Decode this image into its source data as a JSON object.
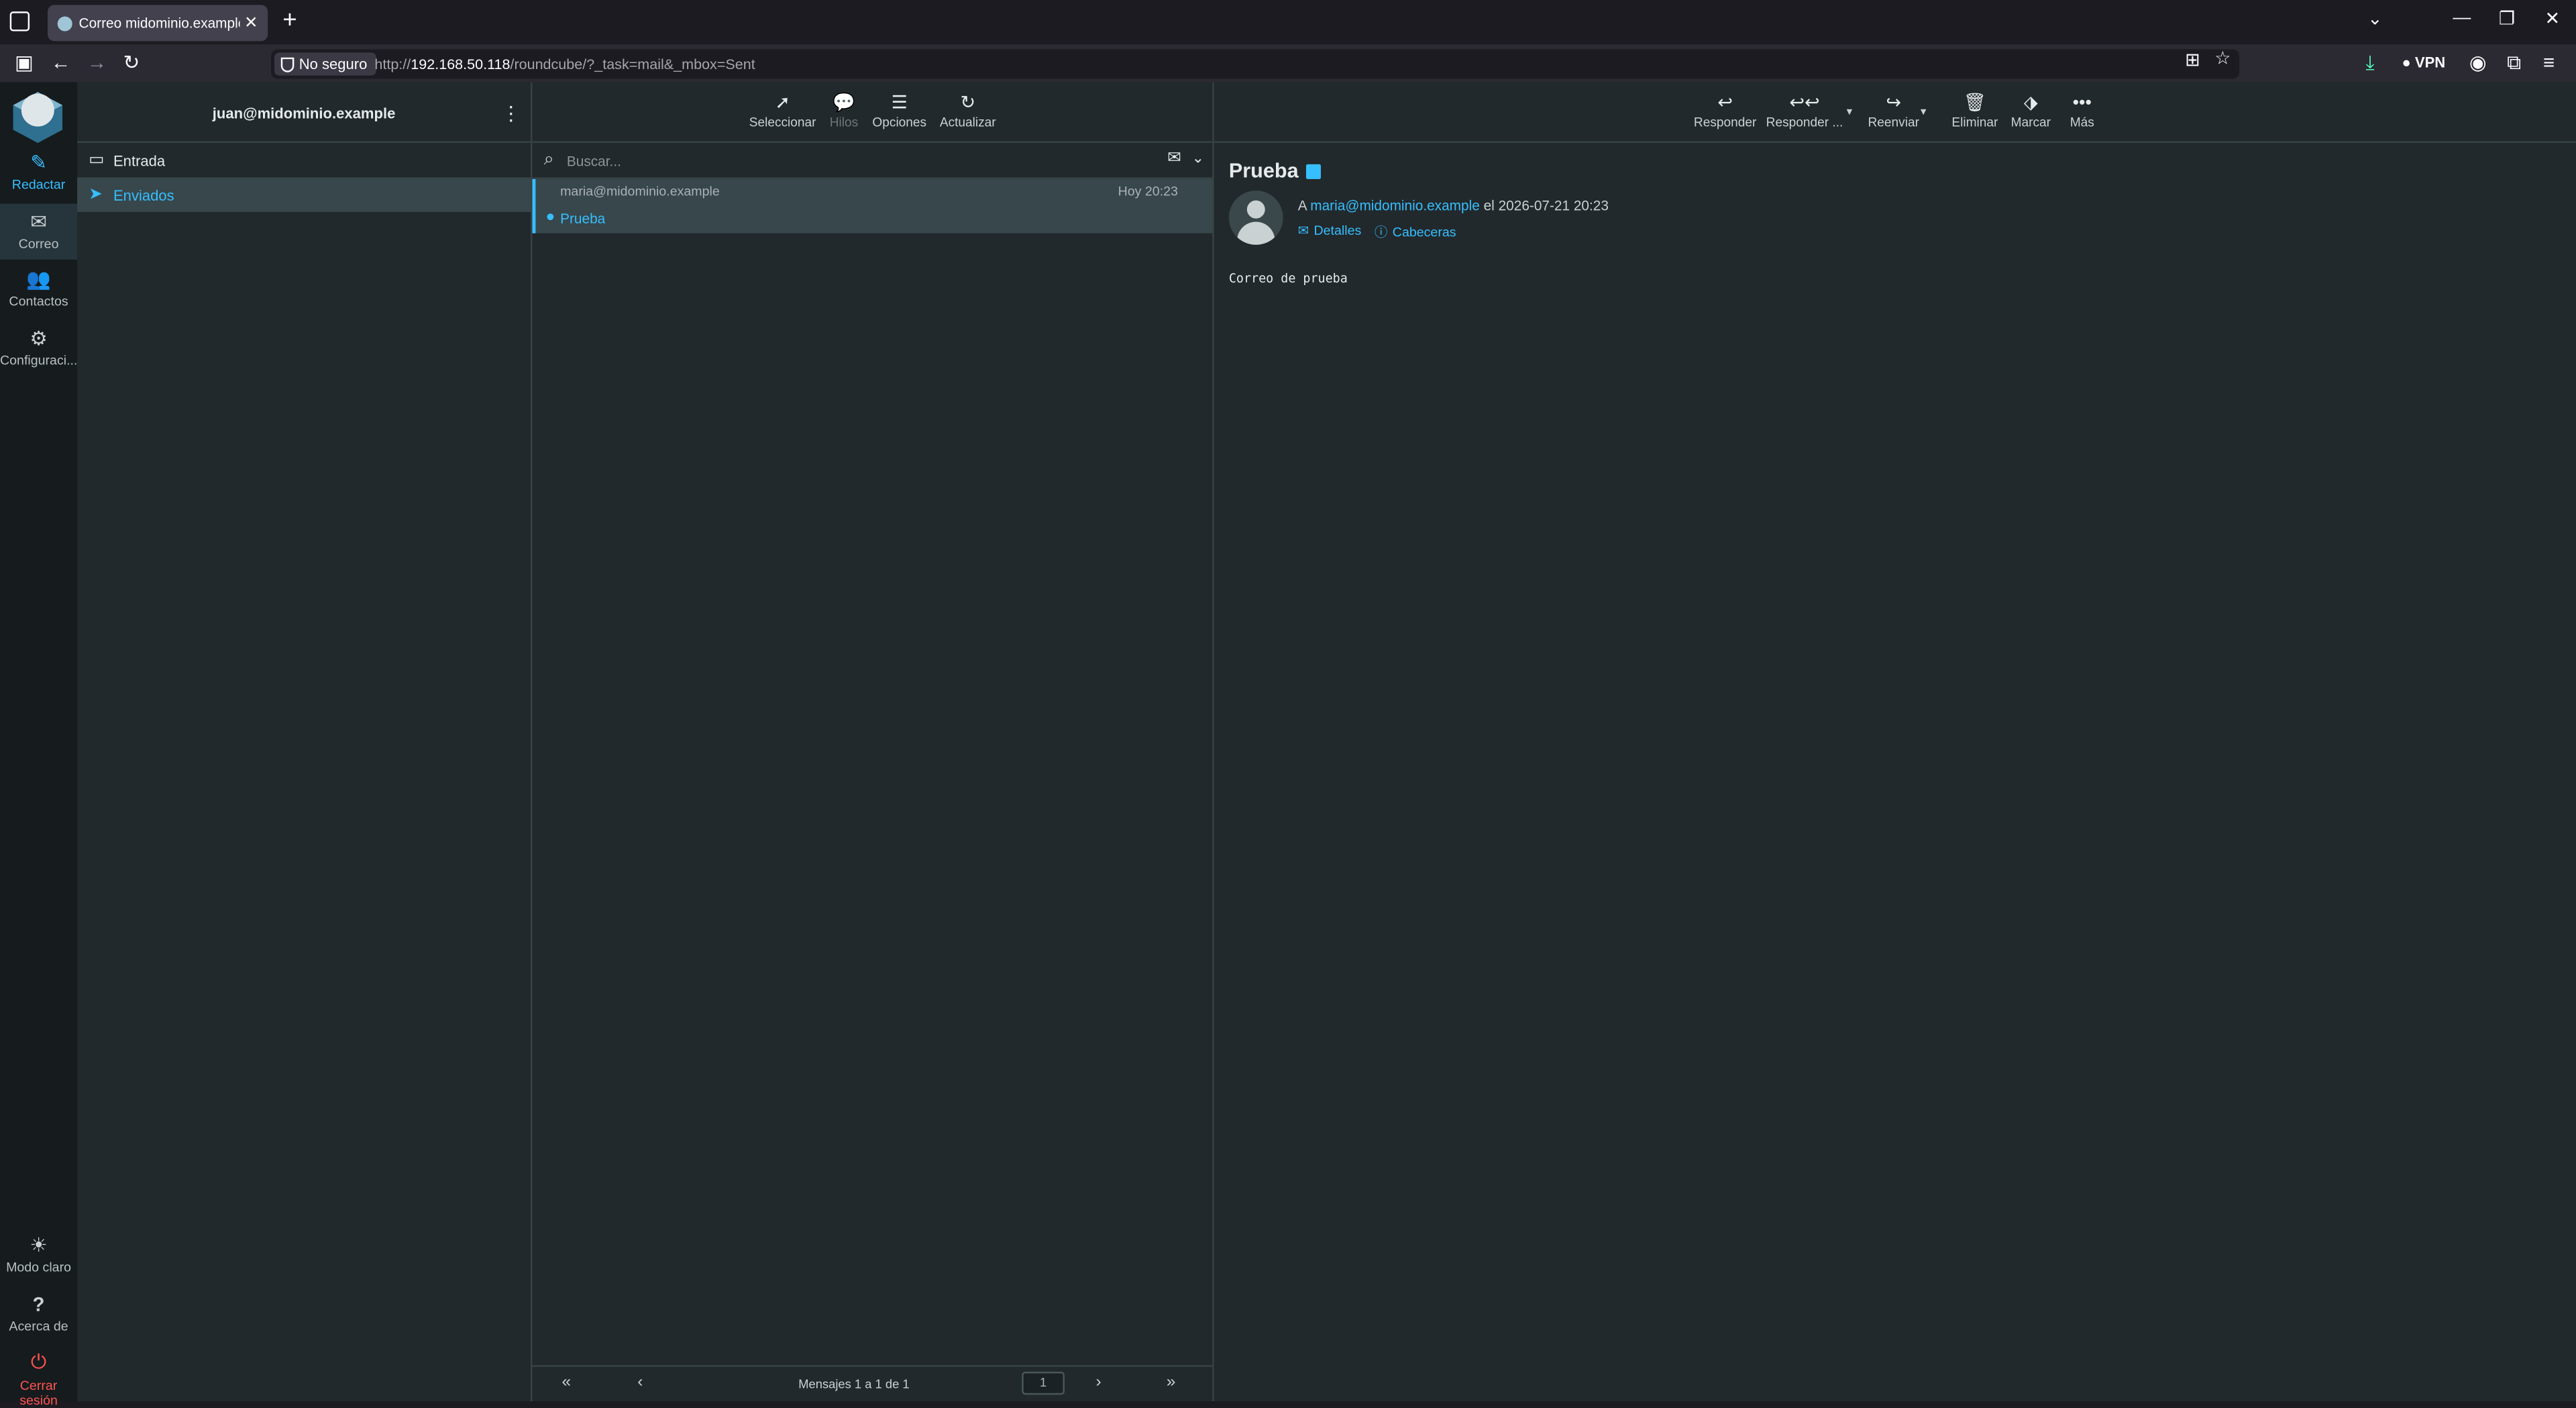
{
  "browser": {
    "tab_title": "Correo midominio.example :: En",
    "not_secure": "No seguro",
    "url_prefix": "http://",
    "url_host": "192.168.50.118",
    "url_rest": "/roundcube/?_task=mail&_mbox=Sent",
    "vpn": "VPN"
  },
  "rail": {
    "compose": "Redactar",
    "mail": "Correo",
    "contacts": "Contactos",
    "settings": "Configuraci...",
    "light_mode": "Modo claro",
    "about": "Acerca de",
    "logout": "Cerrar sesión"
  },
  "folders": {
    "account": "juan@midominio.example",
    "items": [
      {
        "label": "Entrada",
        "icon": "inbox-icon"
      },
      {
        "label": "Enviados",
        "icon": "paper-plane-icon"
      }
    ]
  },
  "list_toolbar": {
    "select": "Seleccionar",
    "threads": "Hilos",
    "options": "Opciones",
    "refresh": "Actualizar"
  },
  "search": {
    "placeholder": "Buscar..."
  },
  "messages": [
    {
      "from": "maria@midominio.example",
      "date": "Hoy 20:23",
      "subject": "Prueba"
    }
  ],
  "pager": {
    "count": "Mensajes 1 a 1 de 1",
    "page": "1"
  },
  "reader_toolbar": {
    "reply": "Responder",
    "reply_all": "Responder ...",
    "forward": "Reenviar",
    "delete": "Eliminar",
    "mark": "Marcar",
    "more": "Más"
  },
  "message": {
    "subject": "Prueba",
    "to_prefix": "A",
    "to": "maria@midominio.example",
    "date_text": "el 2026-07-21 20:23",
    "details": "Detalles",
    "headers": "Cabeceras",
    "body": "Correo de prueba"
  },
  "colors": {
    "accent": "#37beff",
    "background": "#21292c",
    "rail": "#161b1d",
    "selected": "#37474c",
    "logout": "#ff5552"
  }
}
